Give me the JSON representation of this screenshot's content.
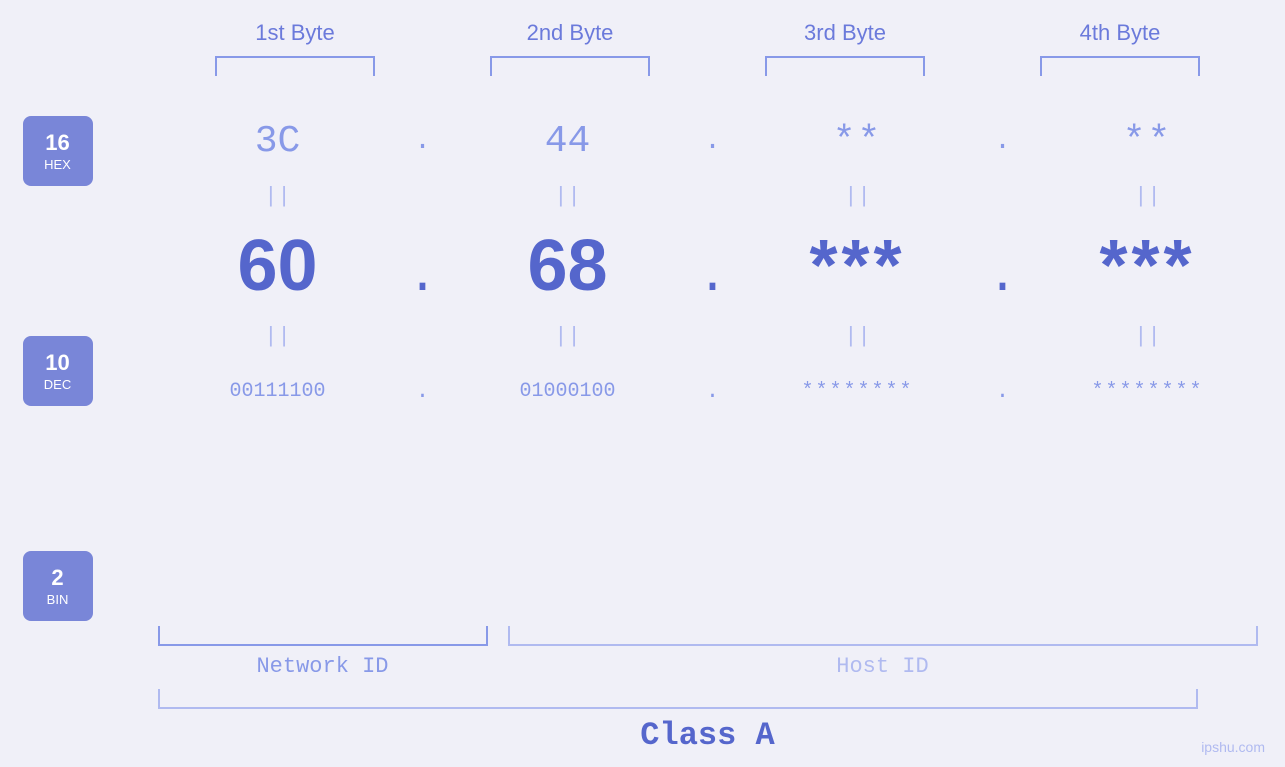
{
  "page": {
    "background": "#f0f0f8",
    "watermark": "ipshu.com"
  },
  "headers": {
    "byte1": "1st Byte",
    "byte2": "2nd Byte",
    "byte3": "3rd Byte",
    "byte4": "4th Byte"
  },
  "badges": {
    "hex": {
      "number": "16",
      "label": "HEX"
    },
    "dec": {
      "number": "10",
      "label": "DEC"
    },
    "bin": {
      "number": "2",
      "label": "BIN"
    }
  },
  "hex": {
    "b1": "3C",
    "b2": "44",
    "b3": "**",
    "b4": "**",
    "sep": "."
  },
  "dec": {
    "b1": "60",
    "b2": "68",
    "b3": "***",
    "b4": "***",
    "sep": "."
  },
  "bin": {
    "b1": "00111100",
    "b2": "01000100",
    "b3": "********",
    "b4": "********",
    "sep": "."
  },
  "labels": {
    "networkId": "Network ID",
    "hostId": "Host ID",
    "classA": "Class A"
  },
  "equals": "||"
}
